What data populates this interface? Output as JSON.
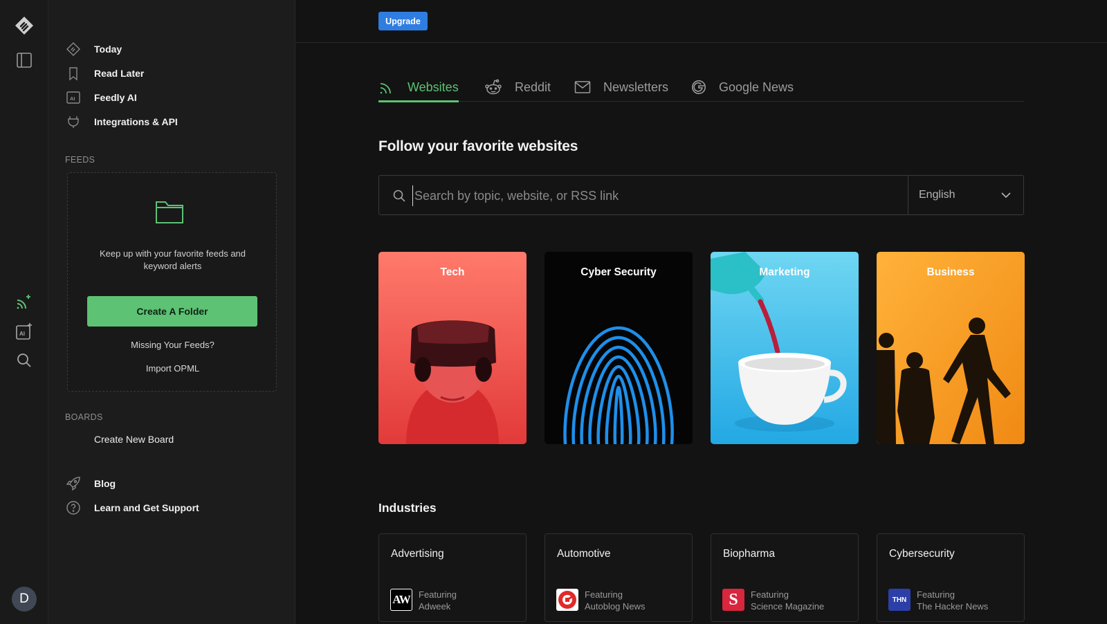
{
  "nav": {
    "today": "Today",
    "read_later": "Read Later",
    "feedly_ai": "Feedly AI",
    "integrations": "Integrations & API",
    "blog": "Blog",
    "support": "Learn and Get Support"
  },
  "feeds": {
    "section": "FEEDS",
    "message": "Keep up with your favorite feeds and keyword alerts",
    "create_folder": "Create A Folder",
    "missing": "Missing Your Feeds?",
    "import": "Import OPML"
  },
  "boards": {
    "section": "BOARDS",
    "create": "Create New Board"
  },
  "avatar": {
    "initial": "D"
  },
  "topbar": {
    "upgrade": "Upgrade"
  },
  "tabs": [
    {
      "label": "Websites",
      "icon": "rss-icon"
    },
    {
      "label": "Reddit",
      "icon": "reddit-icon"
    },
    {
      "label": "Newsletters",
      "icon": "mail-icon"
    },
    {
      "label": "Google News",
      "icon": "google-icon"
    }
  ],
  "headline": "Follow your favorite websites",
  "search": {
    "placeholder": "Search by topic, website, or RSS link",
    "language": "English"
  },
  "topics": [
    {
      "label": "Tech"
    },
    {
      "label": "Cyber Security"
    },
    {
      "label": "Marketing"
    },
    {
      "label": "Business"
    }
  ],
  "industries": {
    "title": "Industries",
    "items": [
      {
        "name": "Advertising",
        "featuring": "Featuring",
        "source": "Adweek",
        "logo": "AW"
      },
      {
        "name": "Automotive",
        "featuring": "Featuring",
        "source": "Autoblog News",
        "logo": ""
      },
      {
        "name": "Biopharma",
        "featuring": "Featuring",
        "source": "Science Magazine",
        "logo": "S"
      },
      {
        "name": "Cybersecurity",
        "featuring": "Featuring",
        "source": "The Hacker News",
        "logo": "THN"
      }
    ]
  },
  "colors": {
    "accent": "#5dc274",
    "upgrade": "#2f7de1",
    "background": "#131313"
  }
}
